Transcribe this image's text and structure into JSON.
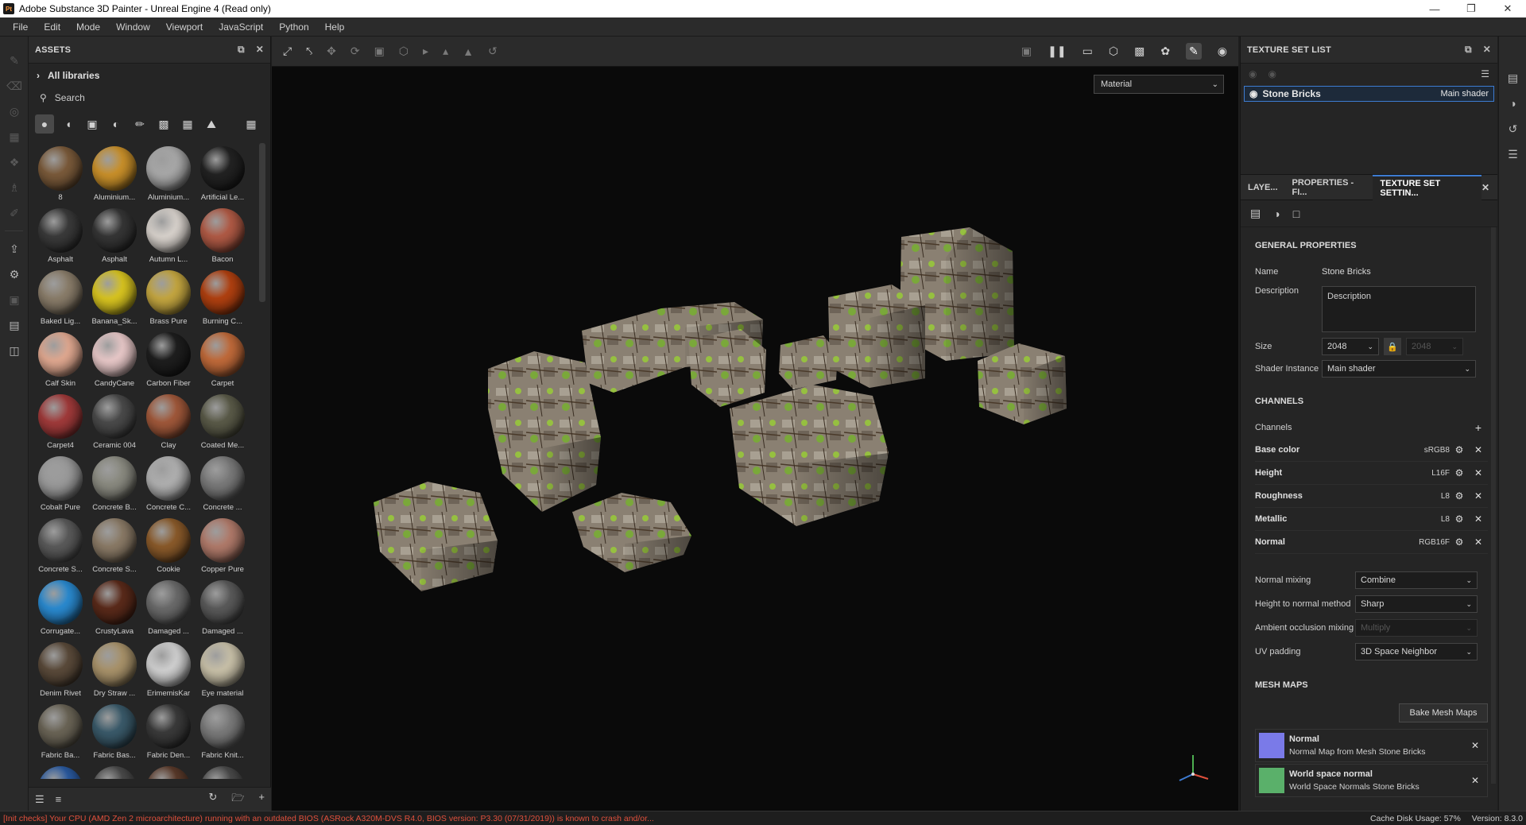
{
  "window": {
    "title": "Adobe Substance 3D Painter - Unreal Engine 4 (Read only)",
    "icon_text": "Pt"
  },
  "menu": [
    "File",
    "Edit",
    "Mode",
    "Window",
    "Viewport",
    "JavaScript",
    "Python",
    "Help"
  ],
  "assets": {
    "header": "ASSETS",
    "library": "All libraries",
    "search_placeholder": "Search",
    "items": [
      {
        "label": "8",
        "color": "#7a5a3a"
      },
      {
        "label": "Aluminium...",
        "color": "#c9902a"
      },
      {
        "label": "Aluminium...",
        "color": "#a8a8a8"
      },
      {
        "label": "Artificial Le...",
        "color": "#222222"
      },
      {
        "label": "Asphalt",
        "color": "#3a3a3a"
      },
      {
        "label": "Asphalt",
        "color": "#353535"
      },
      {
        "label": "Autumn L...",
        "color": "#d8d2cc"
      },
      {
        "label": "Bacon",
        "color": "#b05a45"
      },
      {
        "label": "Baked Lig...",
        "color": "#8a7d6a"
      },
      {
        "label": "Banana_Sk...",
        "color": "#d8c420"
      },
      {
        "label": "Brass Pure",
        "color": "#c4a640"
      },
      {
        "label": "Burning C...",
        "color": "#b04010"
      },
      {
        "label": "Calf Skin",
        "color": "#e0a890"
      },
      {
        "label": "CandyCane",
        "color": "#e8c8c8"
      },
      {
        "label": "Carbon Fiber",
        "color": "#1e1e1e"
      },
      {
        "label": "Carpet",
        "color": "#c06a3a"
      },
      {
        "label": "Carpet4",
        "color": "#a03a3a"
      },
      {
        "label": "Ceramic 004",
        "color": "#4a4a4a"
      },
      {
        "label": "Clay",
        "color": "#a0583a"
      },
      {
        "label": "Coated Me...",
        "color": "#5a5a48"
      },
      {
        "label": "Cobalt Pure",
        "color": "#9a9a9a"
      },
      {
        "label": "Concrete B...",
        "color": "#8a8a80"
      },
      {
        "label": "Concrete C...",
        "color": "#b0b0b0"
      },
      {
        "label": "Concrete ...",
        "color": "#7a7a7a"
      },
      {
        "label": "Concrete S...",
        "color": "#5a5a5a"
      },
      {
        "label": "Concrete S...",
        "color": "#8a7a66"
      },
      {
        "label": "Cookie",
        "color": "#8a5a2a"
      },
      {
        "label": "Copper Pure",
        "color": "#b07a6a"
      },
      {
        "label": "Corrugate...",
        "color": "#2a8ad0"
      },
      {
        "label": "CrustyLava",
        "color": "#5a2a1a"
      },
      {
        "label": "Damaged ...",
        "color": "#6a6a6a"
      },
      {
        "label": "Damaged ...",
        "color": "#5a5a5a"
      },
      {
        "label": "Denim Rivet",
        "color": "#5a4a3a"
      },
      {
        "label": "Dry Straw ...",
        "color": "#a8926a"
      },
      {
        "label": "ErimemisKar",
        "color": "#d0d0d0"
      },
      {
        "label": "Eye material",
        "color": "#c8c0a8"
      },
      {
        "label": "Fabric Ba...",
        "color": "#6a6456"
      },
      {
        "label": "Fabric Bas...",
        "color": "#3a5a6a"
      },
      {
        "label": "Fabric Den...",
        "color": "#3a3a3a"
      },
      {
        "label": "Fabric Knit...",
        "color": "#7a7a7a"
      },
      {
        "label": "",
        "color": "#2a5aa0"
      },
      {
        "label": "",
        "color": "#4a4a4a"
      },
      {
        "label": "",
        "color": "#5a3a2a"
      },
      {
        "label": "",
        "color": "#4a4a4a"
      }
    ]
  },
  "viewport": {
    "material_mode": "Material"
  },
  "texture_set_list": {
    "header": "TEXTURE SET LIST",
    "item_name": "Stone Bricks",
    "item_shader": "Main shader"
  },
  "tabs": [
    "LAYE...",
    "PROPERTIES - FI...",
    "TEXTURE SET SETTIN..."
  ],
  "settings": {
    "general_title": "GENERAL PROPERTIES",
    "name_label": "Name",
    "name_value": "Stone Bricks",
    "description_label": "Description",
    "description_value": "Description",
    "size_label": "Size",
    "size_value": "2048",
    "size_value2": "2048",
    "shader_label": "Shader Instance",
    "shader_value": "Main shader",
    "channels_title": "CHANNELS",
    "channels_label": "Channels",
    "channels": [
      {
        "name": "Base color",
        "format": "sRGB8"
      },
      {
        "name": "Height",
        "format": "L16F"
      },
      {
        "name": "Roughness",
        "format": "L8"
      },
      {
        "name": "Metallic",
        "format": "L8"
      },
      {
        "name": "Normal",
        "format": "RGB16F"
      }
    ],
    "normal_mixing_label": "Normal mixing",
    "normal_mixing_value": "Combine",
    "height_normal_label": "Height to normal method",
    "height_normal_value": "Sharp",
    "ao_mixing_label": "Ambient occlusion mixing",
    "ao_mixing_value": "Multiply",
    "uv_padding_label": "UV padding",
    "uv_padding_value": "3D Space Neighbor",
    "mesh_maps_title": "MESH MAPS",
    "bake_button": "Bake Mesh Maps",
    "mesh_maps": [
      {
        "name": "Normal",
        "desc": "Normal Map from Mesh Stone Bricks",
        "color": "#7a7ae8"
      },
      {
        "name": "World space normal",
        "desc": "World Space Normals Stone Bricks",
        "color": "#5ab06a"
      }
    ]
  },
  "status": {
    "error": "[Init checks] Your CPU (AMD Zen 2 microarchitecture) running with an outdated BIOS (ASRock A320M-DVS R4.0, BIOS version: P3.30 (07/31/2019)) is known to crash and/or...",
    "cache": "Cache Disk Usage:",
    "cache_value": "57%",
    "version": "Version: 8.3.0"
  }
}
